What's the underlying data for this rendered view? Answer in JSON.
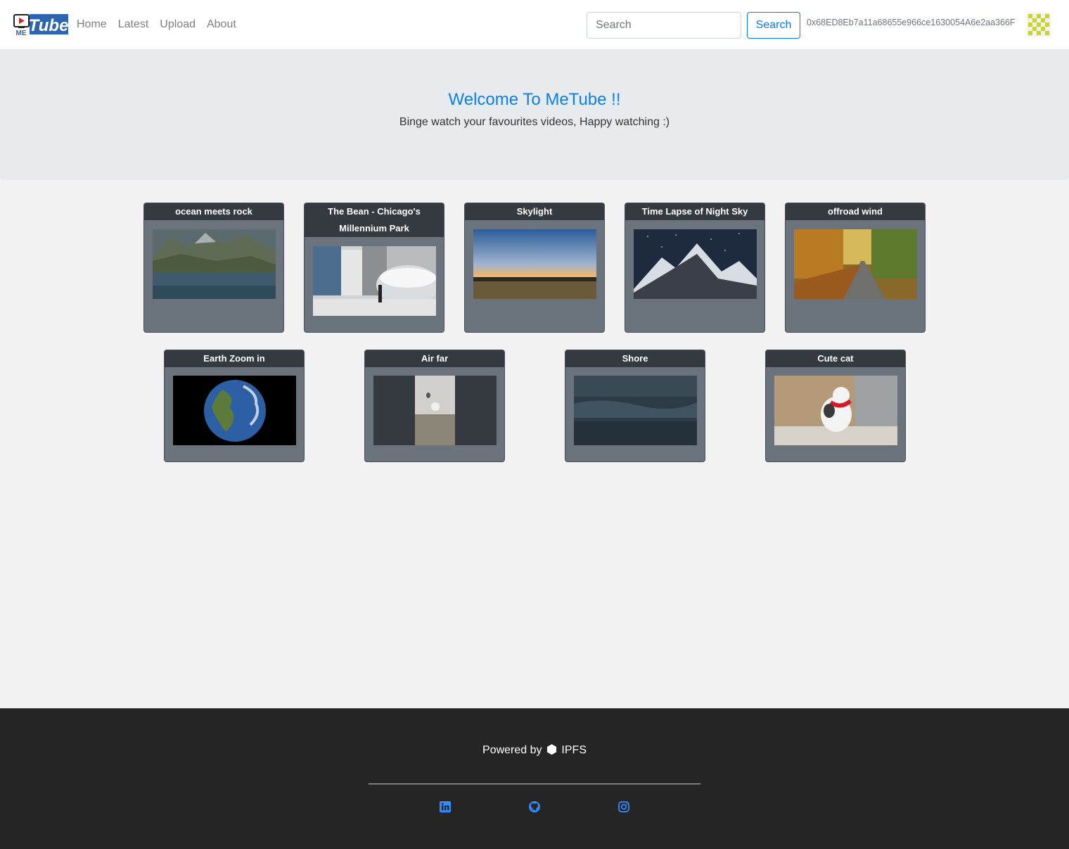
{
  "navbar": {
    "logo_text": "MeTube",
    "links": [
      {
        "label": "Home"
      },
      {
        "label": "Latest"
      },
      {
        "label": "Upload"
      },
      {
        "label": "About"
      }
    ],
    "search_placeholder": "Search",
    "search_button": "Search",
    "account": "0x68ED8Eb7a11a68655e966ce1630054A6e2aa366F"
  },
  "hero": {
    "title": "Welcome To MeTube !!",
    "subtitle": "Binge watch your favourites videos, Happy watching :)"
  },
  "videos": [
    {
      "title": "ocean meets rock",
      "thumb": "mountain-lake-image"
    },
    {
      "title": "The Bean - Chicago's Millennium Park",
      "thumb": "chicago-bean-image"
    },
    {
      "title": "Skylight",
      "thumb": "sunset-sky-image"
    },
    {
      "title": "Time Lapse of Night Sky",
      "thumb": "night-sky-mountain-image"
    },
    {
      "title": "offroad wind",
      "thumb": "autumn-road-image"
    },
    {
      "title": "Earth Zoom in",
      "thumb": "earth-image"
    },
    {
      "title": "Air far",
      "thumb": "hot-air-balloon-image"
    },
    {
      "title": "Shore",
      "thumb": "shore-waves-image"
    },
    {
      "title": "Cute cat",
      "thumb": "cat-image"
    }
  ],
  "footer": {
    "powered_by": "Powered by",
    "ipfs_label": "IPFS",
    "socials": [
      "linkedin-icon",
      "github-icon",
      "instagram-icon"
    ]
  },
  "colors": {
    "accent": "#007bff",
    "hero_title": "#0d7fe6",
    "card_header": "#343a40",
    "card_body": "#6b747c",
    "footer_bg": "#252525"
  }
}
